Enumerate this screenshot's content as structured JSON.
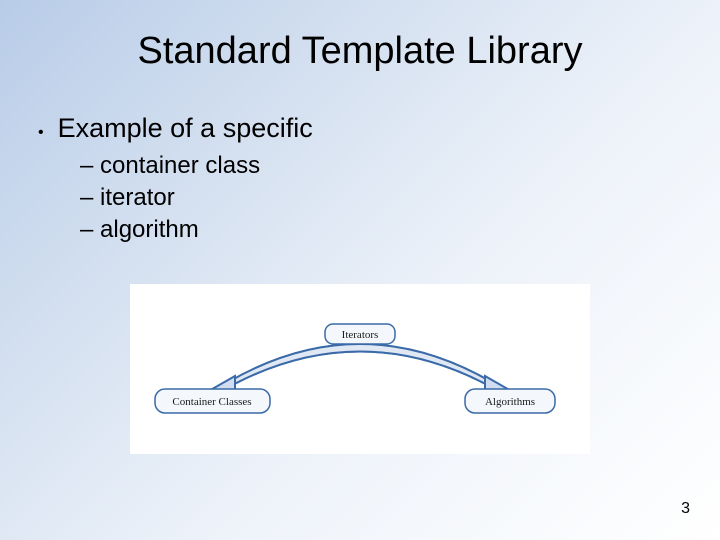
{
  "title": "Standard Template Library",
  "bullet": "Example of a specific",
  "sub_items": [
    "container class",
    "iterator",
    "algorithm"
  ],
  "diagram": {
    "top_label": "Iterators",
    "left_label": "Container Classes",
    "right_label": "Algorithms"
  },
  "page_number": "3"
}
